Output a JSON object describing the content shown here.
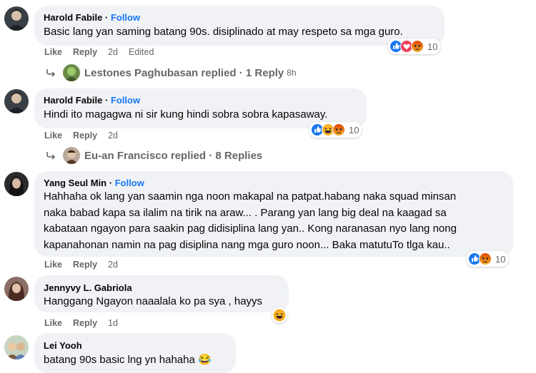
{
  "comments": [
    {
      "author": "Harold Fabile",
      "follow": "Follow",
      "lines": [
        "Basic lang yan saming batang 90s. disiplinado at may respeto sa mga guro."
      ],
      "like": "Like",
      "reply": "Reply",
      "time": "2d",
      "edited": "Edited",
      "reactions": [
        "like-icon",
        "love-icon",
        "angry-icon"
      ],
      "reaction_count": "10",
      "replies": {
        "name": "Lestones Paghubasan",
        "label": "replied",
        "sep": "·",
        "count": "1 Reply",
        "time": "8h"
      }
    },
    {
      "author": "Harold Fabile",
      "follow": "Follow",
      "lines": [
        "Hindi ito magagwa ni sir kung hindi sobra sobra kapasaway."
      ],
      "like": "Like",
      "reply": "Reply",
      "time": "2d",
      "reactions": [
        "like-icon",
        "haha-icon",
        "angry-icon"
      ],
      "reaction_count": "10",
      "replies": {
        "name": "Eu-an Francisco",
        "label": "replied",
        "sep": "·",
        "count": "8 Replies"
      }
    },
    {
      "author": "Yang Seul Min",
      "follow": "Follow",
      "lines": [
        "Hahhaha ok lang yan saamin nga noon makapal na patpat.habang naka squad minsan",
        "naka babad kapa sa ilalim na tirik na araw... . Parang yan lang big deal na kaagad sa",
        "kabataan ngayon para saakin pag didisiplina lang yan.. Kong naranasan nyo lang nong",
        "kapanahonan namin na pag disiplina nang mga guro noon... Baka matutuTo tlga kau.."
      ],
      "like": "Like",
      "reply": "Reply",
      "time": "2d",
      "reactions": [
        "like-icon",
        "angry-icon"
      ],
      "reaction_count": "10"
    },
    {
      "author": "Jennyvy L. Gabriola",
      "lines": [
        "Hanggang Ngayon naaalala ko pa sya , hayys"
      ],
      "like": "Like",
      "reply": "Reply",
      "time": "1d",
      "reactions": [
        "haha-icon"
      ]
    },
    {
      "author": "Lei Yooh",
      "lines": [
        "batang 90s basic lng yn hahaha 😂"
      ]
    }
  ],
  "colors": {
    "bubble": "#f0f2f5",
    "follow": "#1877f2",
    "meta": "#65676b",
    "like": "#1877f2",
    "love": "#f33e58",
    "angry": "#e9710f",
    "haha": "#f7b125"
  }
}
